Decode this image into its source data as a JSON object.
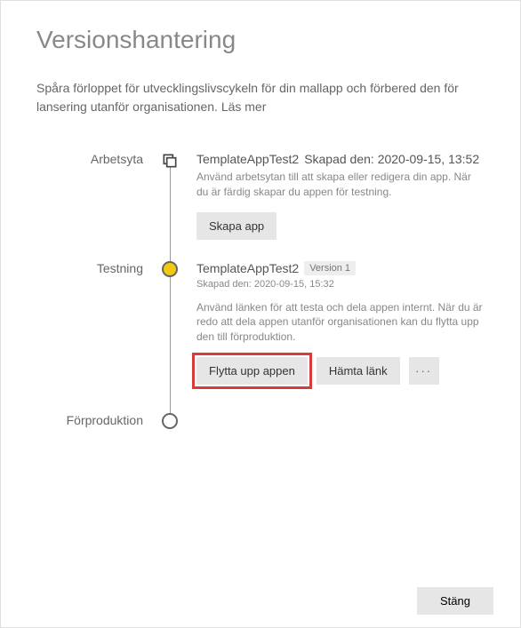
{
  "header": {
    "title": "Versionshantering",
    "intro_text": "Spåra förloppet för utvecklingslivscykeln för din mallapp och förbered den för lansering utanför organisationen. ",
    "learn_more": "Läs mer"
  },
  "stages": {
    "workspace": {
      "label": "Arbetsyta",
      "app_name": "TemplateAppTest2",
      "created_text": "Skapad den: 2020-09-15, 13:52",
      "description": "Använd arbetsytan till att skapa eller redigera din app. När du är färdig skapar du appen för testning.",
      "create_button": "Skapa app"
    },
    "testing": {
      "label": "Testning",
      "app_name": "TemplateAppTest2",
      "version_badge": "Version 1",
      "created_text": "Skapad den: 2020-09-15, 15:32",
      "description": "Använd länken för att testa och dela appen internt. När du är redo att dela appen utanför organisationen kan du flytta upp den till förproduktion.",
      "promote_button": "Flytta upp appen",
      "get_link_button": "Hämta länk",
      "more_button": "···"
    },
    "preprod": {
      "label": "Förproduktion"
    }
  },
  "footer": {
    "close_button": "Stäng"
  },
  "colors": {
    "accent": "#f2c811",
    "highlight_border": "#d93a3a"
  }
}
